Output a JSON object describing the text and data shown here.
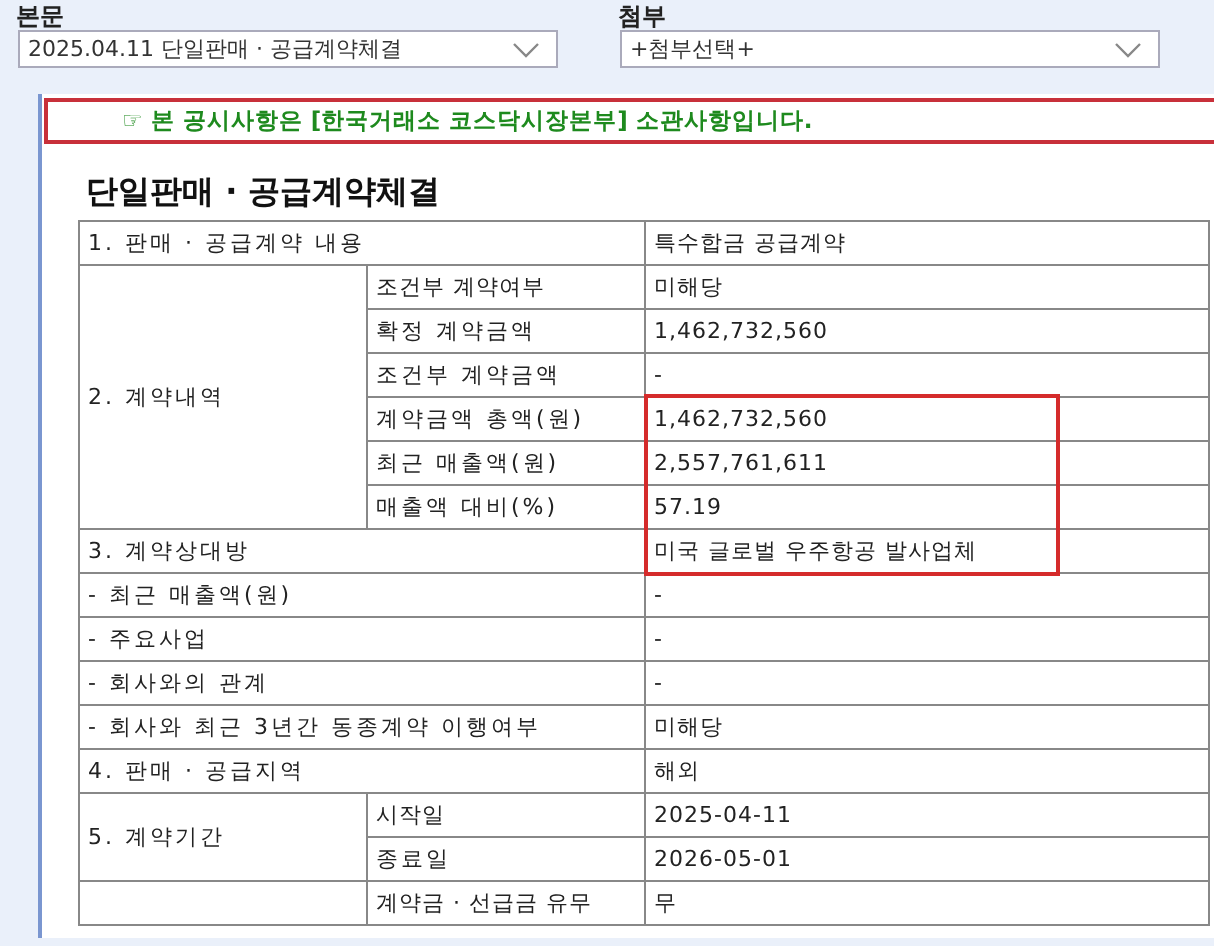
{
  "selectors": [
    {
      "label": "본문",
      "value": "2025.04.11   단일판매 · 공급계약체결"
    },
    {
      "label": "첨부",
      "value": "+첨부선택+"
    }
  ],
  "notice": "☞ 본 공시사항은 [한국거래소 코스닥시장본부] 소관사항입니다.",
  "document_title": "단일판매 · 공급계약체결",
  "table": {
    "rows": [
      {
        "kind": "single",
        "label": "1. 판매 · 공급계약 내용",
        "value": "특수합금 공급계약",
        "highlighted": false
      },
      {
        "kind": "group",
        "label": "2. 계약내역",
        "items": [
          {
            "label": "조건부 계약여부",
            "value": "미해당",
            "highlighted": false
          },
          {
            "label": "확정 계약금액",
            "value": "1,462,732,560",
            "highlighted": false
          },
          {
            "label": "조건부 계약금액",
            "value": "-",
            "highlighted": false
          },
          {
            "label": "계약금액 총액(원)",
            "value": "1,462,732,560",
            "highlighted": true
          },
          {
            "label": "최근 매출액(원)",
            "value": "2,557,761,611",
            "highlighted": true
          },
          {
            "label": "매출액 대비(%)",
            "value": "57.19",
            "highlighted": true
          }
        ]
      },
      {
        "kind": "single",
        "label": "3. 계약상대방",
        "value": "미국 글로벌 우주항공 발사업체",
        "highlighted": true
      },
      {
        "kind": "single",
        "label": "- 최근 매출액(원)",
        "value": "-",
        "highlighted": false
      },
      {
        "kind": "single",
        "label": "- 주요사업",
        "value": "-",
        "highlighted": false
      },
      {
        "kind": "single",
        "label": "- 회사와의 관계",
        "value": "-",
        "highlighted": false
      },
      {
        "kind": "single",
        "label": "- 회사와 최근 3년간 동종계약 이행여부",
        "value": "미해당",
        "highlighted": false
      },
      {
        "kind": "single",
        "label": "4. 판매 · 공급지역",
        "value": "해외",
        "highlighted": false
      },
      {
        "kind": "group",
        "label": "5. 계약기간",
        "items": [
          {
            "label": "시작일",
            "value": "2025-04-11",
            "highlighted": false
          },
          {
            "label": "종료일",
            "value": "2026-05-01",
            "highlighted": false
          }
        ]
      },
      {
        "kind": "group",
        "label": "",
        "items": [
          {
            "label": "계약금 · 선급금 유무",
            "value": "무",
            "highlighted": false
          }
        ]
      }
    ]
  }
}
